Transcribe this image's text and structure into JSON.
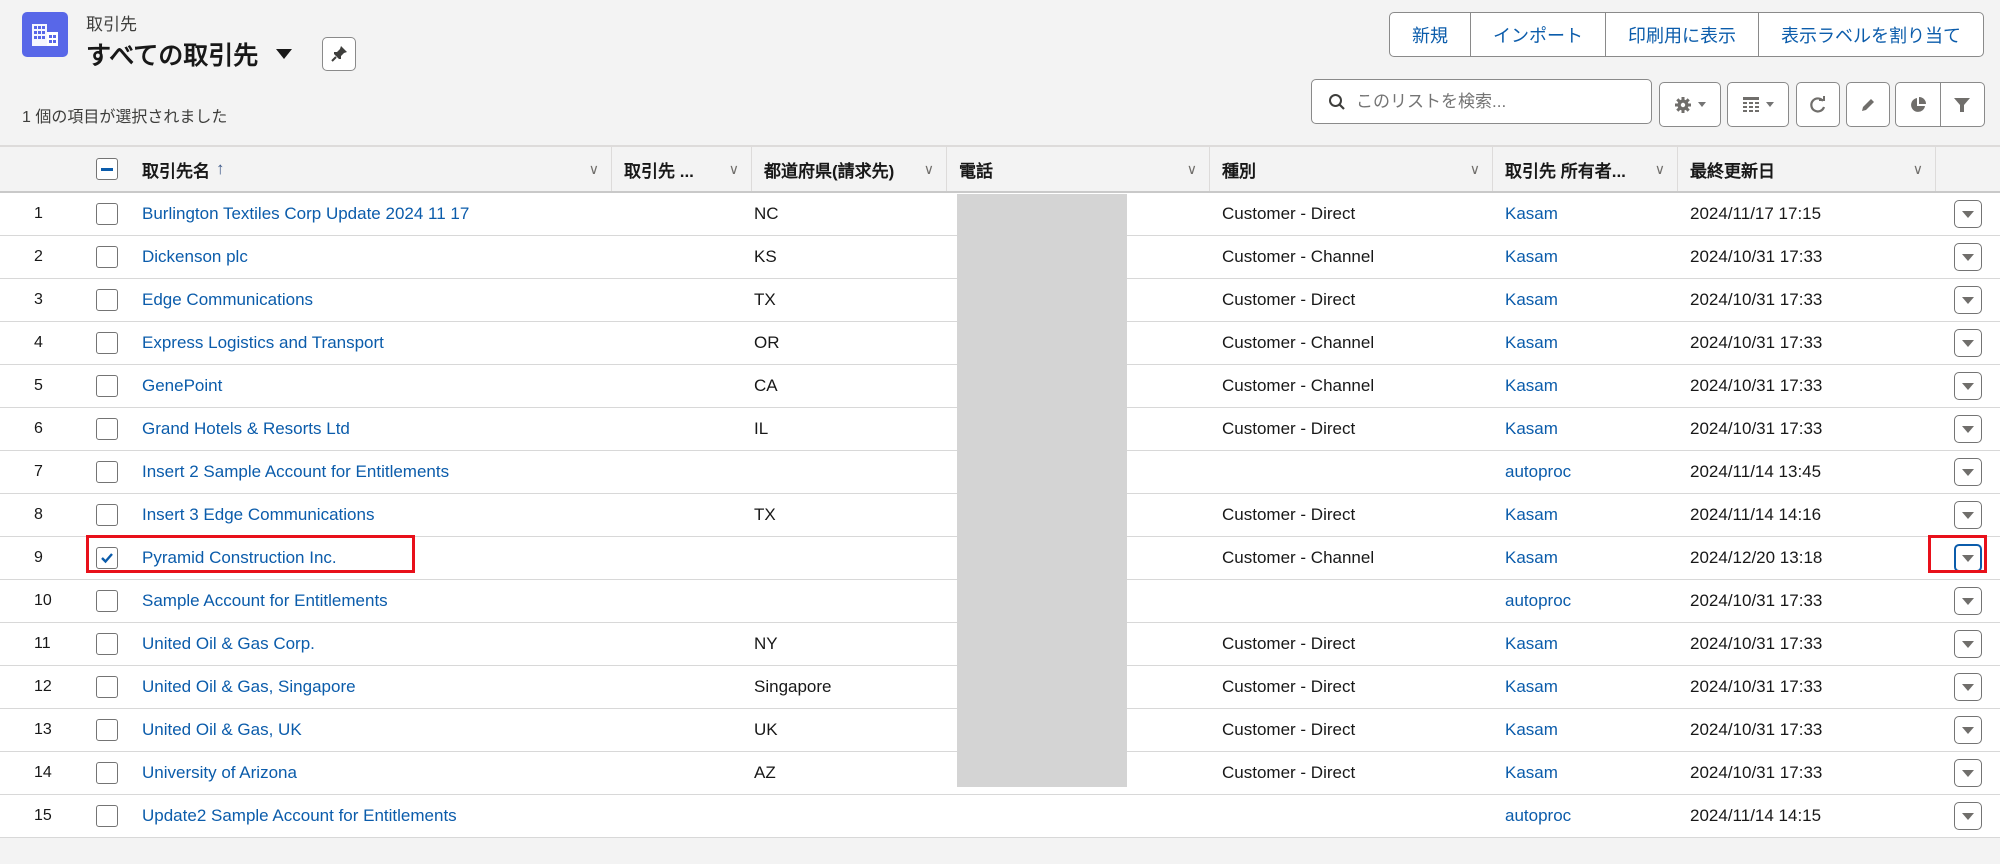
{
  "header": {
    "object_label": "取引先",
    "list_view_title": "すべての取引先",
    "selected_count_text": "1 個の項目が選択されました",
    "icon": "account-building-icon"
  },
  "actions": {
    "new": "新規",
    "import": "インポート",
    "printable_view": "印刷用に表示",
    "assign_label": "表示ラベルを割り当て"
  },
  "search": {
    "placeholder": "このリストを検索...",
    "value": ""
  },
  "toolbar": {
    "icons": [
      "gear-icon",
      "table-display-icon",
      "refresh-icon",
      "edit-icon",
      "chart-icon",
      "filter-icon"
    ]
  },
  "columns": [
    {
      "label": "取引先名",
      "sorted": "asc"
    },
    {
      "label": "取引先 ..."
    },
    {
      "label": "都道府県(請求先)"
    },
    {
      "label": "電話"
    },
    {
      "label": "種別"
    },
    {
      "label": "取引先 所有者..."
    },
    {
      "label": "最終更新日"
    }
  ],
  "rows": [
    {
      "num": "1",
      "name": "Burlington Textiles Corp Update 2024 11 17",
      "site": "",
      "state": "NC",
      "type": "Customer - Direct",
      "owner": "Kasam",
      "modified": "2024/11/17 17:15",
      "checked": false
    },
    {
      "num": "2",
      "name": "Dickenson plc",
      "site": "",
      "state": "KS",
      "type": "Customer - Channel",
      "owner": "Kasam",
      "modified": "2024/10/31 17:33",
      "checked": false
    },
    {
      "num": "3",
      "name": "Edge Communications",
      "site": "",
      "state": "TX",
      "type": "Customer - Direct",
      "owner": "Kasam",
      "modified": "2024/10/31 17:33",
      "checked": false
    },
    {
      "num": "4",
      "name": "Express Logistics and Transport",
      "site": "",
      "state": "OR",
      "type": "Customer - Channel",
      "owner": "Kasam",
      "modified": "2024/10/31 17:33",
      "checked": false
    },
    {
      "num": "5",
      "name": "GenePoint",
      "site": "",
      "state": "CA",
      "type": "Customer - Channel",
      "owner": "Kasam",
      "modified": "2024/10/31 17:33",
      "checked": false
    },
    {
      "num": "6",
      "name": "Grand Hotels & Resorts Ltd",
      "site": "",
      "state": "IL",
      "type": "Customer - Direct",
      "owner": "Kasam",
      "modified": "2024/10/31 17:33",
      "checked": false
    },
    {
      "num": "7",
      "name": "Insert 2 Sample Account for Entitlements",
      "site": "",
      "state": "",
      "type": "",
      "owner": "autoproc",
      "modified": "2024/11/14 13:45",
      "checked": false
    },
    {
      "num": "8",
      "name": "Insert 3 Edge Communications",
      "site": "",
      "state": "TX",
      "type": "Customer - Direct",
      "owner": "Kasam",
      "modified": "2024/11/14 14:16",
      "checked": false
    },
    {
      "num": "9",
      "name": "Pyramid Construction Inc.",
      "site": "",
      "state": "",
      "type": "Customer - Channel",
      "owner": "Kasam",
      "modified": "2024/12/20 13:18",
      "checked": true
    },
    {
      "num": "10",
      "name": "Sample Account for Entitlements",
      "site": "",
      "state": "",
      "type": "",
      "owner": "autoproc",
      "modified": "2024/10/31 17:33",
      "checked": false
    },
    {
      "num": "11",
      "name": "United Oil & Gas Corp.",
      "site": "",
      "state": "NY",
      "type": "Customer - Direct",
      "owner": "Kasam",
      "modified": "2024/10/31 17:33",
      "checked": false
    },
    {
      "num": "12",
      "name": "United Oil & Gas, Singapore",
      "site": "",
      "state": "Singapore",
      "type": "Customer - Direct",
      "owner": "Kasam",
      "modified": "2024/10/31 17:33",
      "checked": false
    },
    {
      "num": "13",
      "name": "United Oil & Gas, UK",
      "site": "",
      "state": "UK",
      "type": "Customer - Direct",
      "owner": "Kasam",
      "modified": "2024/10/31 17:33",
      "checked": false
    },
    {
      "num": "14",
      "name": "University of Arizona",
      "site": "",
      "state": "AZ",
      "type": "Customer - Direct",
      "owner": "Kasam",
      "modified": "2024/10/31 17:33",
      "checked": false
    },
    {
      "num": "15",
      "name": "Update2 Sample Account for Entitlements",
      "site": "",
      "state": "",
      "type": "",
      "owner": "autoproc",
      "modified": "2024/11/14 14:15",
      "checked": false
    }
  ],
  "colors": {
    "link": "#0b5cab",
    "brand_icon": "#5867e8",
    "highlight": "#e8101a",
    "phone_mask": "#d4d4d4"
  }
}
